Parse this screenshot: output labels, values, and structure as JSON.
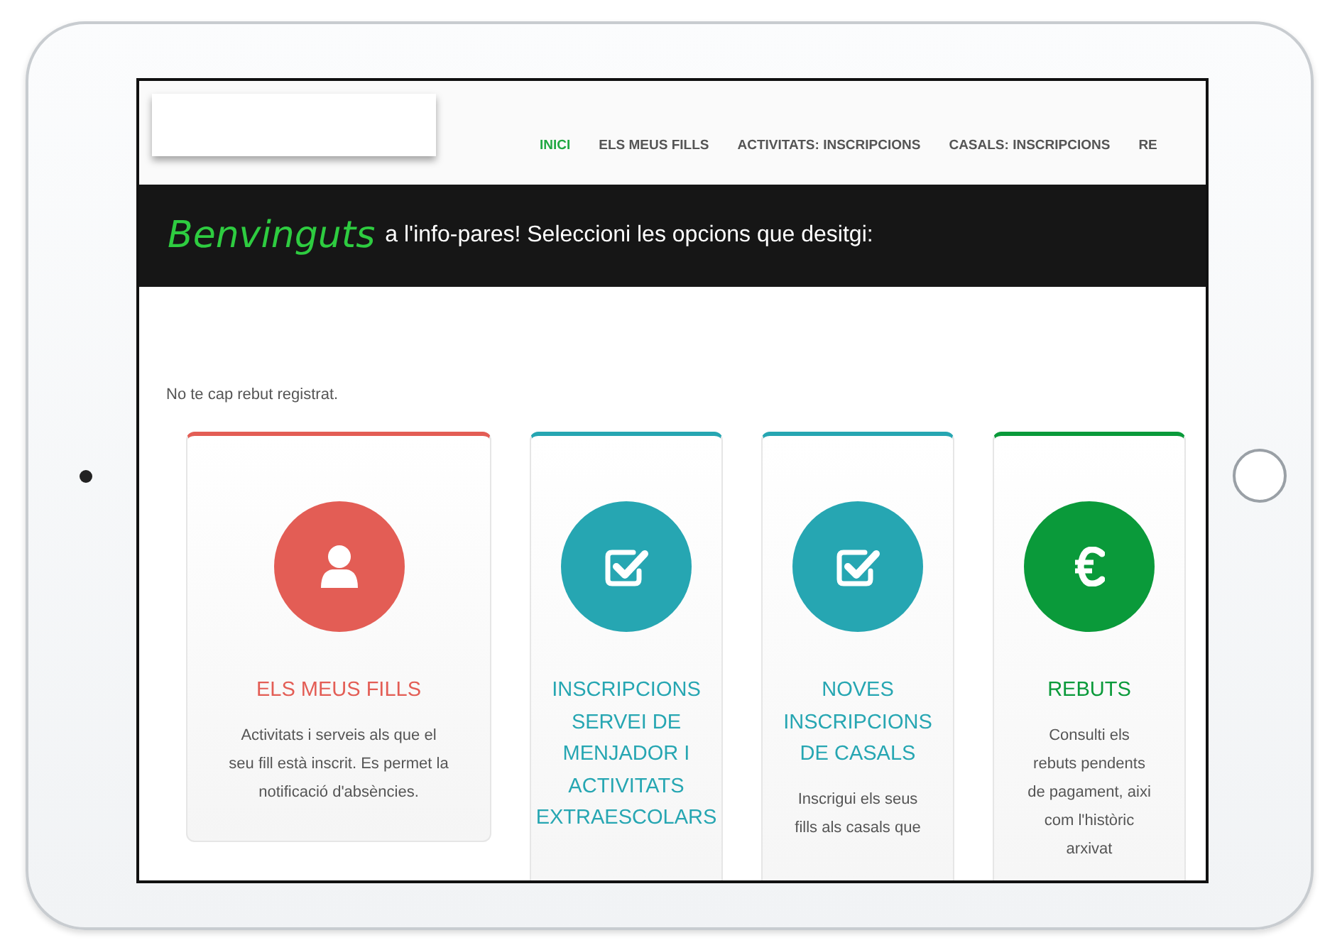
{
  "nav": {
    "items": [
      {
        "label": "INICI",
        "selected": true
      },
      {
        "label": "ELS MEUS FILLS",
        "selected": false
      },
      {
        "label": "ACTIVITATS: INSCRIPCIONS",
        "selected": false
      },
      {
        "label": "CASALS: INSCRIPCIONS",
        "selected": false
      },
      {
        "label": "RE",
        "selected": false
      }
    ]
  },
  "banner": {
    "highlight": "Benvinguts",
    "text": "a l'info-pares! Seleccioni les opcions que desitgi:"
  },
  "notice": "No te cap rebut registrat.",
  "cards": [
    {
      "kind": "person",
      "color": "#e35d55",
      "title": "ELS MEUS FILLS",
      "description": "Activitats i serveis als que el seu fill està inscrit. Es permet la notificació d'absències."
    },
    {
      "kind": "check",
      "color": "#26a6b2",
      "title": "INSCRIPCIONS SERVEI DE MENJADOR I ACTIVITATS EXTRAESCOLARS"
    },
    {
      "kind": "check",
      "color": "#26a6b2",
      "title": "NOVES INSCRIPCIONS DE CASALS",
      "description": "Inscrigui els seus fills als casals que"
    },
    {
      "kind": "euro",
      "color": "#0a9a3a",
      "title": "REBUTS",
      "description": "Consulti els rebuts pendents de pagament, aixi com l'històric arxivat"
    }
  ]
}
